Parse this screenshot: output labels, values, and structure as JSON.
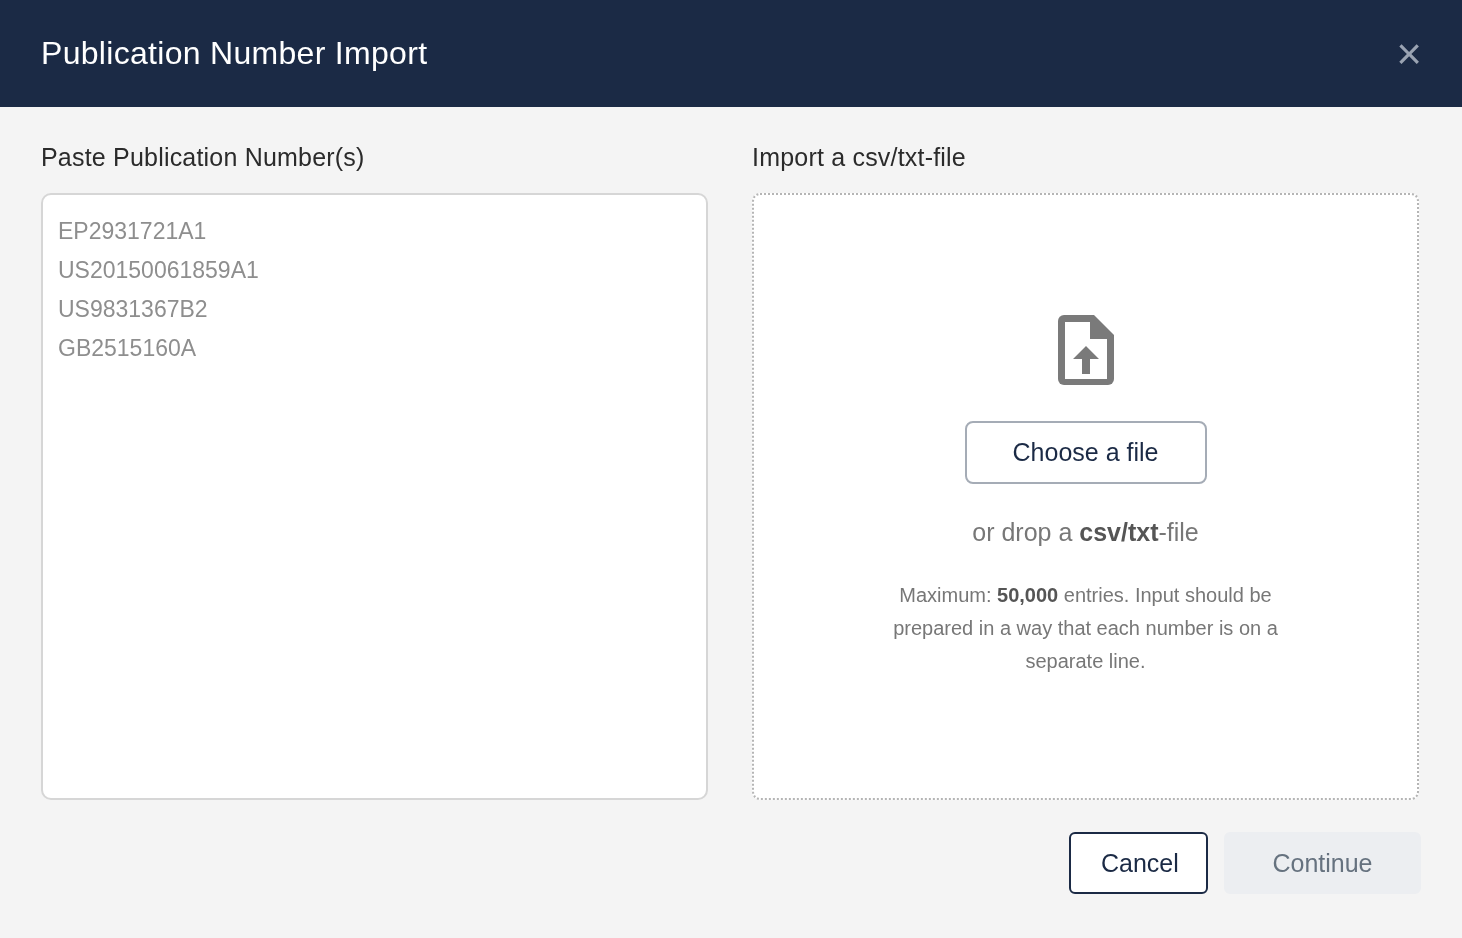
{
  "window": {
    "title": "Publication Number Import",
    "close": "×"
  },
  "paste": {
    "label": "Paste Publication Number(s)",
    "placeholder": "EP2931721A1\nUS20150061859A1\nUS9831367B2\nGB2515160A"
  },
  "import": {
    "label": "Import a csv/txt-file",
    "choose_button": "Choose a file",
    "drop_hint": "or drop a **csv/txt**-file",
    "note": "Maximum: **50,000** entries. Input should be prepared in a way that each number is on a separate line."
  },
  "buttons": [
    {
      "label": "Cancel",
      "kind": "secondary",
      "disabled": false
    },
    {
      "label": "Continue",
      "kind": "primary",
      "disabled": true
    }
  ]
}
